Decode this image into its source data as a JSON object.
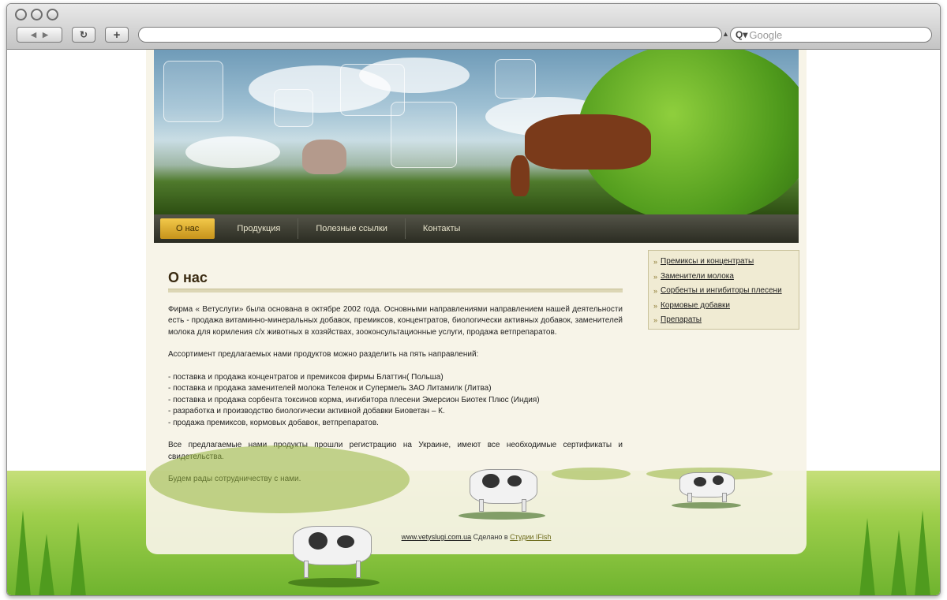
{
  "browser": {
    "search_placeholder": "Google",
    "back_label": "◀",
    "forward_label": "▶",
    "reload_label": "↻",
    "add_label": "+"
  },
  "menu": {
    "items": [
      {
        "label": "О нас",
        "active": true
      },
      {
        "label": "Продукция"
      },
      {
        "label": "Полезные ссылки"
      },
      {
        "label": "Контакты"
      }
    ]
  },
  "sidebar": {
    "links": [
      "Премиксы и концентраты",
      "Заменители молока",
      "Сорбенты и ингибиторы плесени",
      "Кормовые добавки",
      "Препараты"
    ]
  },
  "content": {
    "title": "О нас",
    "p1": "Фирма « Ветуслуги» была основана в октябре 2002 года. Основными направлениями направлением нашей деятельности есть - продажа витаминно-минеральных добавок, премиксов, концентратов, биологически активных добавок, заменителей молока для кормления с/х животных в хозяйствах, зооконсультационные услуги, продажа ветпрепаратов.",
    "p2": "Ассортимент предлагаемых нами продуктов можно разделить на пять направлений:",
    "list": [
      "- поставка и продажа концентратов и премиксов фирмы Блаттин( Польша)",
      "- поставка и продажа заменителей молока Теленок и Супермель ЗАО Литамилк (Литва)",
      "- поставка и продажа сорбента токсинов корма, ингибитора плесени Эмерсион Биотек Плюс (Индия)",
      "- разработка и производство биологически активной добавки Биоветан – К.",
      "- продажа премиксов, кормовых добавок, ветпрепаратов."
    ],
    "p3": "Все предлагаемые нами продукты прошли регистрацию на Украине, имеют все необходимые сертификаты и свидетельства.",
    "p4": "Будем рады сотрудничеству с нами."
  },
  "footer": {
    "site_link": "www.vetyslugi.com.ua",
    "made_by": "Сделано в",
    "studio_link": "Студии IFish"
  }
}
